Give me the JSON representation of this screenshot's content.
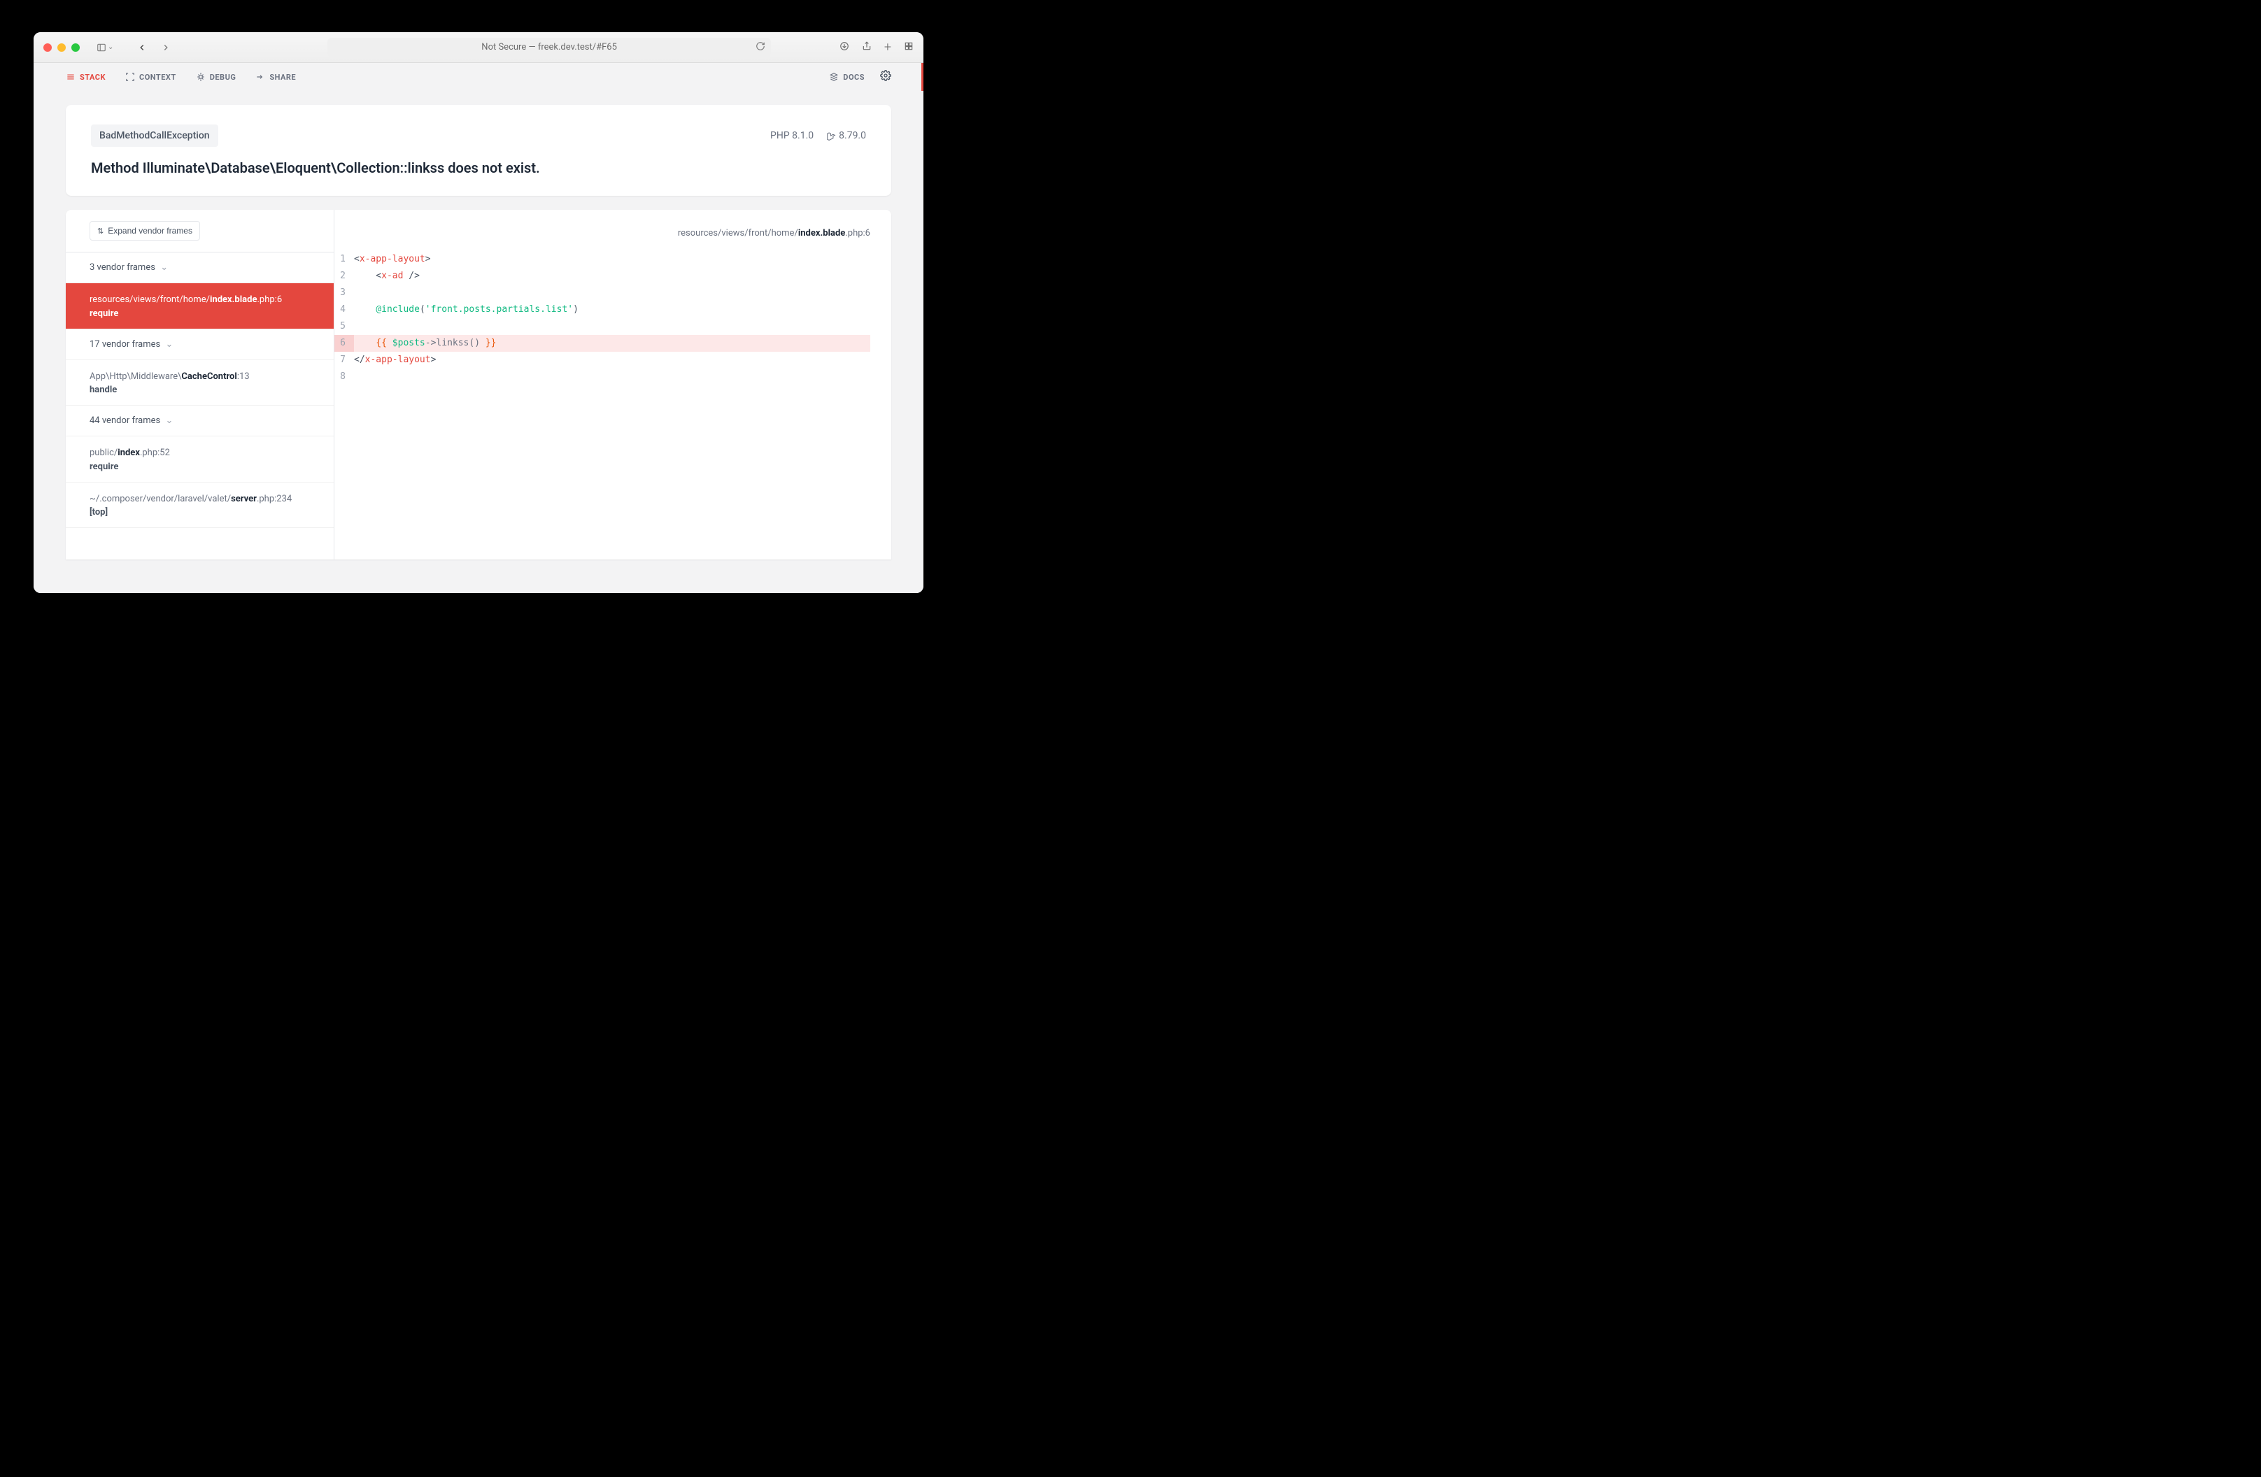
{
  "browser": {
    "address": "Not Secure — freek.dev.test/#F65"
  },
  "tabs": {
    "stack": "STACK",
    "context": "CONTEXT",
    "debug": "DEBUG",
    "share": "SHARE",
    "docs": "DOCS"
  },
  "exception": {
    "class": "BadMethodCallException",
    "message": "Method Illuminate\\Database\\Eloquent\\Collection::linkss does not exist.",
    "php_version": "PHP 8.1.0",
    "laravel_version": "8.79.0"
  },
  "frames": {
    "expand_label": "Expand vendor frames",
    "group1": "3 vendor frames",
    "active_path_prefix": "resources/views/front/home/",
    "active_path_strong": "index.blade",
    "active_path_suffix": ".php:6",
    "active_method": "require",
    "group2": "17 vendor frames",
    "frame2_path_prefix": "App\\Http\\Middleware\\",
    "frame2_path_strong": "CacheControl",
    "frame2_path_suffix": ":13",
    "frame2_method": "handle",
    "group3": "44 vendor frames",
    "frame3_path_prefix": "public/",
    "frame3_path_strong": "index",
    "frame3_path_suffix": ".php:52",
    "frame3_method": "require",
    "frame4_path_prefix": "~/.composer/vendor/laravel/valet/",
    "frame4_path_strong": "server",
    "frame4_path_suffix": ".php:234",
    "frame4_method": "[top]"
  },
  "code": {
    "path_prefix": "resources/views/front/home/",
    "path_strong": "index.blade",
    "path_suffix": ".php:6",
    "lines": {
      "l1": "1",
      "l2": "2",
      "l3": "3",
      "l4": "4",
      "l5": "5",
      "l6": "6",
      "l7": "7",
      "l8": "8"
    },
    "line1_tag": "x-app-layout",
    "line2_tag": "x-ad",
    "line4_dir": "@include",
    "line4_arg": "'front.posts.partials.list'",
    "line6_open": "{{ ",
    "line6_var": "$posts",
    "line6_call": "->linkss() ",
    "line6_close": "}}",
    "line7_tag": "x-app-layout"
  }
}
